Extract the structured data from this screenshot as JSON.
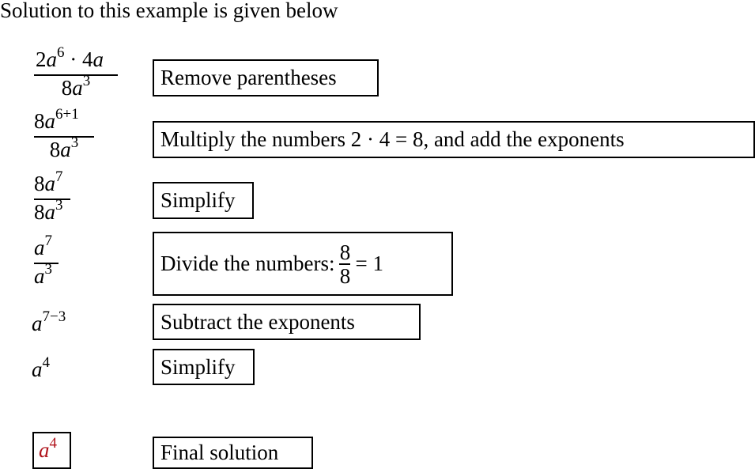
{
  "title": "Solution to this example is given below",
  "steps": [
    {
      "expr": {
        "num": [
          "2",
          "a",
          "6",
          " · 4",
          "a"
        ],
        "den": [
          "8",
          "a",
          "3"
        ]
      },
      "explanation": "Remove parentheses"
    },
    {
      "expr": {
        "num": [
          "8",
          "a",
          "6+1"
        ],
        "den": [
          "8",
          "a",
          "3"
        ]
      },
      "explanation": "Multiply the numbers 2 · 4 = 8,  and add the exponents"
    },
    {
      "expr": {
        "num": [
          "8",
          "a",
          "7"
        ],
        "den": [
          "8",
          "a",
          "3"
        ]
      },
      "explanation": "Simplify"
    },
    {
      "expr": {
        "num": [
          "",
          "a",
          "7"
        ],
        "den": [
          "",
          "a",
          "3"
        ]
      },
      "explanation_prefix": "Divide the numbers:",
      "explanation_frac": {
        "num": "8",
        "den": "8"
      },
      "explanation_suffix": "= 1"
    },
    {
      "expr": {
        "base": "a",
        "exp": "7−3"
      },
      "explanation": "Subtract the exponents"
    },
    {
      "expr": {
        "base": "a",
        "exp": "4"
      },
      "explanation": "Simplify"
    }
  ],
  "final": {
    "base": "a",
    "exp": "4",
    "color": "#b0141c",
    "explanation": "Final solution"
  }
}
